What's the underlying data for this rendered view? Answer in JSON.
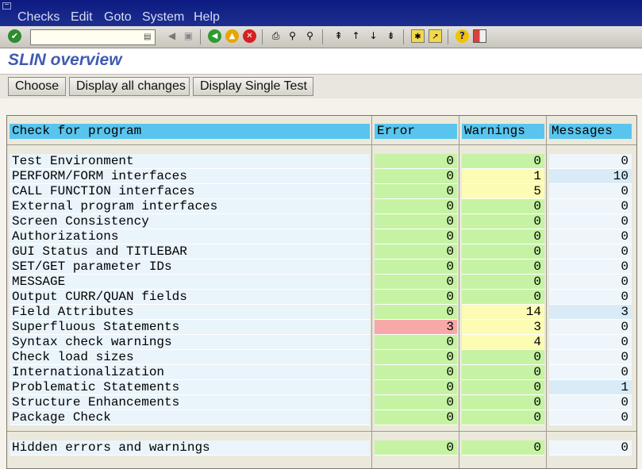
{
  "menu": [
    "Checks",
    "Edit",
    "Goto",
    "System",
    "Help"
  ],
  "toolbar_icons": [
    "enter-icon",
    "back-icon",
    "exit-icon",
    "cancel-icon",
    "print-icon",
    "find-icon",
    "find-next-icon",
    "first-page-icon",
    "prev-page-icon",
    "next-page-icon",
    "last-page-icon",
    "create-session-icon",
    "shortcut-icon",
    "help-icon",
    "layout-icon"
  ],
  "command_field": {
    "value": ""
  },
  "page_title": "SLIN overview",
  "buttons": {
    "choose": "Choose",
    "display_all_changes": "Display all changes",
    "display_single_test": "Display Single Test"
  },
  "table": {
    "headers": {
      "check": "Check for program",
      "error": "Error",
      "warnings": "Warnings",
      "messages": "Messages"
    },
    "rows": [
      {
        "label": "Test Environment",
        "error": "0",
        "warnings": "0",
        "messages": "0"
      },
      {
        "label": "PERFORM/FORM interfaces",
        "error": "0",
        "warnings": "1",
        "messages": "10"
      },
      {
        "label": "CALL FUNCTION interfaces",
        "error": "0",
        "warnings": "5",
        "messages": "0"
      },
      {
        "label": "External program interfaces",
        "error": "0",
        "warnings": "0",
        "messages": "0"
      },
      {
        "label": "Screen Consistency",
        "error": "0",
        "warnings": "0",
        "messages": "0"
      },
      {
        "label": "Authorizations",
        "error": "0",
        "warnings": "0",
        "messages": "0"
      },
      {
        "label": "GUI Status and TITLEBAR",
        "error": "0",
        "warnings": "0",
        "messages": "0"
      },
      {
        "label": "SET/GET parameter IDs",
        "error": "0",
        "warnings": "0",
        "messages": "0"
      },
      {
        "label": "MESSAGE",
        "error": "0",
        "warnings": "0",
        "messages": "0"
      },
      {
        "label": "Output CURR/QUAN fields",
        "error": "0",
        "warnings": "0",
        "messages": "0"
      },
      {
        "label": "Field Attributes",
        "error": "0",
        "warnings": "14",
        "messages": "3"
      },
      {
        "label": "Superfluous Statements",
        "error": "3",
        "warnings": "3",
        "messages": "0"
      },
      {
        "label": "Syntax check warnings",
        "error": "0",
        "warnings": "4",
        "messages": "0"
      },
      {
        "label": "Check load sizes",
        "error": "0",
        "warnings": "0",
        "messages": "0"
      },
      {
        "label": "Internationalization",
        "error": "0",
        "warnings": "0",
        "messages": "0"
      },
      {
        "label": "Problematic Statements",
        "error": "0",
        "warnings": "0",
        "messages": "1"
      },
      {
        "label": "Structure Enhancements",
        "error": "0",
        "warnings": "0",
        "messages": "0"
      },
      {
        "label": "Package Check",
        "error": "0",
        "warnings": "0",
        "messages": "0"
      }
    ],
    "total": {
      "label": "Hidden errors and warnings",
      "error": "0",
      "warnings": "0",
      "messages": "0"
    }
  },
  "colors": {
    "header": "#59c5ee",
    "ok": "#c5f3a3",
    "warning": "#fcfcb4",
    "error": "#f7a8a8",
    "message": "#d8ebf7",
    "title": "#3f5bb1"
  }
}
